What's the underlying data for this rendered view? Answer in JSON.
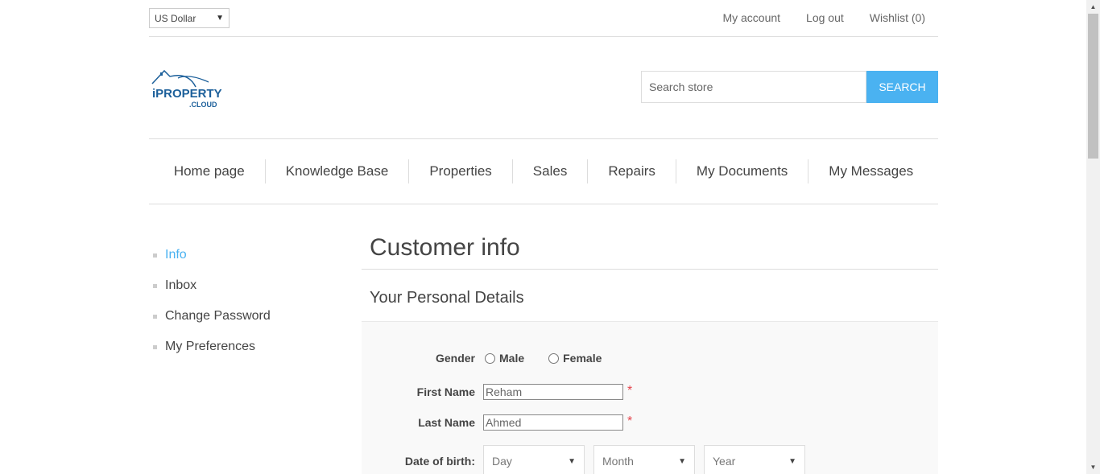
{
  "header": {
    "currency": "US Dollar",
    "links": [
      "My account",
      "Log out",
      "Wishlist (0)"
    ]
  },
  "logo": {
    "line1": "iPROPERTY",
    "line2": ".CLOUD"
  },
  "search": {
    "placeholder": "Search store",
    "button": "Search"
  },
  "nav": [
    "Home page",
    "Knowledge Base",
    "Properties",
    "Sales",
    "Repairs",
    "My Documents",
    "My Messages"
  ],
  "side_menu": [
    {
      "label": "Info",
      "active": true
    },
    {
      "label": "Inbox",
      "active": false
    },
    {
      "label": "Change Password",
      "active": false
    },
    {
      "label": "My Preferences",
      "active": false
    }
  ],
  "main": {
    "title": "Customer info",
    "section": "Your Personal Details",
    "form": {
      "gender_label": "Gender",
      "gender_options": [
        "Male",
        "Female"
      ],
      "first_name_label": "First Name",
      "first_name_value": "Reham",
      "last_name_label": "Last Name",
      "last_name_value": "Ahmed",
      "required_mark": "*",
      "dob_label": "Date of birth:",
      "dob_day": "Day",
      "dob_month": "Month",
      "dob_year": "Year"
    }
  },
  "colors": {
    "accent": "#4ab2f1",
    "required": "#e4444c"
  }
}
